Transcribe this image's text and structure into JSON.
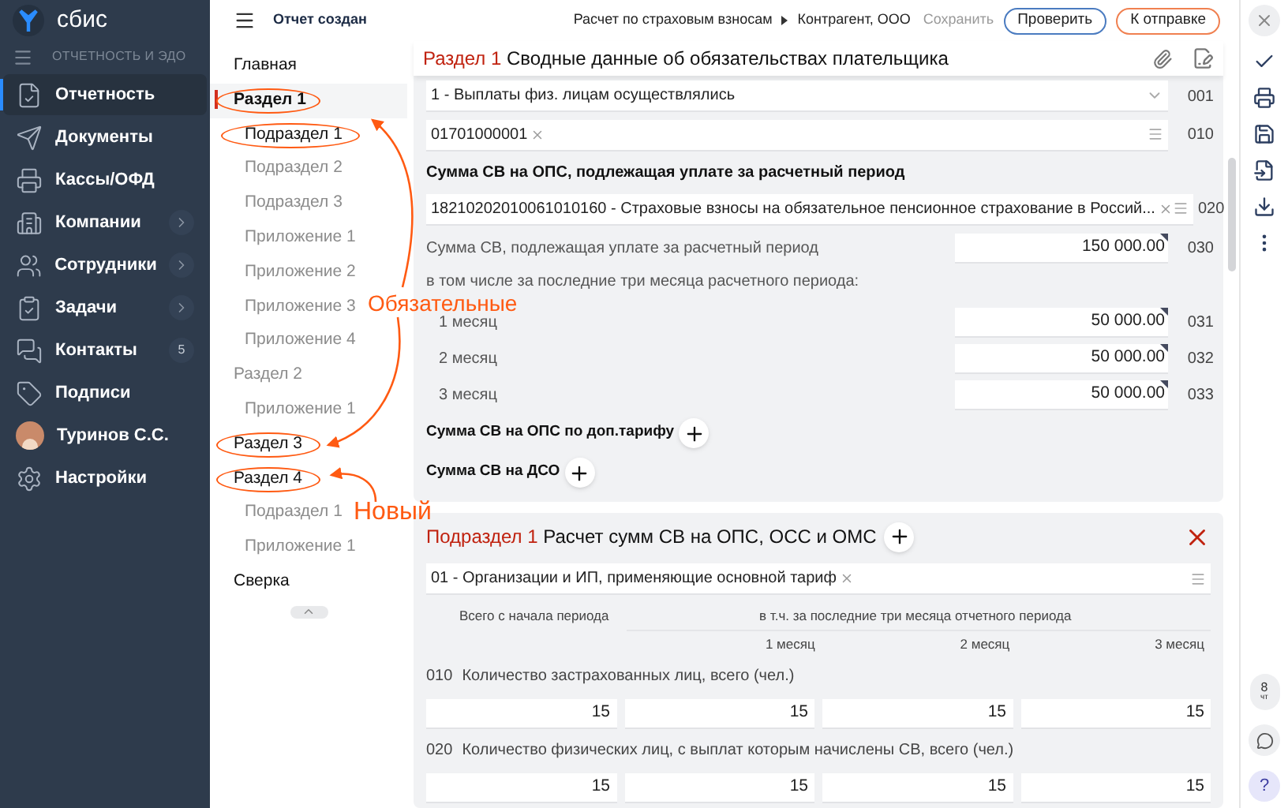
{
  "sidebar": {
    "brand": "сбис",
    "section": "ОТЧЕТНОСТЬ И ЭДО",
    "items": [
      {
        "label": "Отчетность",
        "selected": true
      },
      {
        "label": "Документы",
        "selected": false
      },
      {
        "label": "Кассы/ОФД",
        "selected": false
      },
      {
        "label": "Компании",
        "selected": false,
        "expandable": true
      },
      {
        "label": "Сотрудники",
        "selected": false,
        "expandable": true
      },
      {
        "label": "Задачи",
        "selected": false,
        "expandable": true
      },
      {
        "label": "Контакты",
        "selected": false,
        "count": "5"
      },
      {
        "label": "Подписи",
        "selected": false
      },
      {
        "label": "Туринов С.С.",
        "selected": false,
        "kind": "user"
      },
      {
        "label": "Настройки",
        "selected": false
      }
    ]
  },
  "header": {
    "status": "Отчет создан",
    "breadcrumb": [
      "Расчет по страховым взносам",
      "Контрагент, ООО"
    ],
    "save": "Сохранить",
    "buttons": [
      {
        "label": "Проверить",
        "kind": "check"
      },
      {
        "label": "К отправке",
        "kind": "send"
      }
    ]
  },
  "nav": [
    {
      "label": "Главная",
      "filled": true,
      "selected": false,
      "circled": false
    },
    {
      "label": "Раздел 1",
      "filled": true,
      "selected": true,
      "circled": true,
      "children": [
        {
          "label": "Подраздел 1",
          "filled": true,
          "selected": false,
          "circled": true
        },
        {
          "label": "Подраздел 2",
          "filled": false,
          "selected": false,
          "circled": false
        },
        {
          "label": "Подраздел 3",
          "filled": false,
          "selected": false,
          "circled": false
        },
        {
          "label": "Приложение 1",
          "filled": false,
          "selected": false,
          "circled": false
        },
        {
          "label": "Приложение 2",
          "filled": false,
          "selected": false,
          "circled": false
        },
        {
          "label": "Приложение 3",
          "filled": false,
          "selected": false,
          "circled": false
        },
        {
          "label": "Приложение 4",
          "filled": false,
          "selected": false,
          "circled": false
        }
      ]
    },
    {
      "label": "Раздел 2",
      "filled": false,
      "selected": false,
      "circled": false,
      "children": [
        {
          "label": "Приложение 1",
          "filled": false,
          "selected": false,
          "circled": false
        }
      ]
    },
    {
      "label": "Раздел 3",
      "filled": true,
      "selected": false,
      "circled": true
    },
    {
      "label": "Раздел 4",
      "filled": true,
      "selected": false,
      "circled": true,
      "children": [
        {
          "label": "Подраздел 1",
          "filled": false,
          "selected": false,
          "circled": false
        },
        {
          "label": "Приложение 1",
          "filled": false,
          "selected": false,
          "circled": false
        }
      ]
    },
    {
      "label": "Сверка",
      "filled": true,
      "selected": false,
      "circled": false
    }
  ],
  "section1": {
    "prefix": "Раздел 1",
    "title": "Сводные данные об обязательствах плательщика",
    "rows": [
      {
        "kind": "select",
        "value": "1 - Выплаты физ. лицам осуществлялись",
        "code": "001"
      },
      {
        "kind": "field",
        "value": "01701000001",
        "code": "010"
      },
      {
        "kind": "heading",
        "label": "Сумма СВ на ОПС, подлежащая уплате за расчетный период"
      },
      {
        "kind": "field",
        "value": "18210202010061010160 - Страховые взносы на обязательное пенсионное страхование в Россий...",
        "code": "020"
      },
      {
        "kind": "amount",
        "label": "Сумма СВ, подлежащая уплате за расчетный период",
        "value": "150 000.00",
        "code": "030"
      },
      {
        "kind": "note",
        "label": "в том числе за последние три месяца расчетного периода:"
      },
      {
        "kind": "month",
        "label": "1 месяц",
        "value": "50 000.00",
        "code": "031"
      },
      {
        "kind": "month",
        "label": "2 месяц",
        "value": "50 000.00",
        "code": "032"
      },
      {
        "kind": "month",
        "label": "3 месяц",
        "value": "50 000.00",
        "code": "033"
      },
      {
        "kind": "add",
        "label": "Сумма СВ на ОПС по доп.тарифу"
      },
      {
        "kind": "add",
        "label": "Сумма СВ на ДСО"
      }
    ]
  },
  "section2": {
    "prefix": "Подраздел 1",
    "title": "Расчет сумм СВ на ОПС, ОСС и ОМС",
    "tariff": "01 - Организации и ИП, применяющие основной тариф",
    "total_header": "Всего с начала периода",
    "months_header": "в т.ч. за последние три месяца отчетного периода",
    "months": [
      "1 месяц",
      "2 месяц",
      "3 месяц"
    ],
    "rows": [
      {
        "code": "010",
        "label": "Количество застрахованных лиц, всего (чел.)",
        "values": [
          "15",
          "15",
          "15",
          "15"
        ]
      },
      {
        "code": "020",
        "label": "Количество физических лиц, с выплат которым начислены СВ, всего (чел.)",
        "values": [
          "15",
          "15",
          "15",
          "15"
        ]
      }
    ]
  },
  "toolbar": {
    "day": "8",
    "weekday": "чт",
    "help": "?"
  },
  "annotations": [
    {
      "text": "Обязательные"
    },
    {
      "text": "Новый"
    }
  ]
}
